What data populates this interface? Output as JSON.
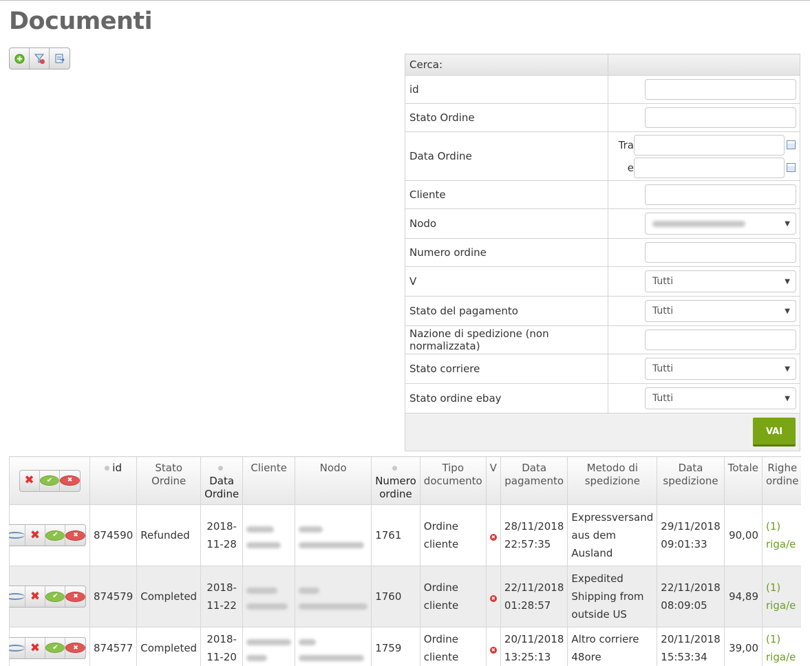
{
  "page": {
    "title": "Documenti"
  },
  "toolbar": {
    "icons": [
      "add-icon",
      "clear-filter-icon",
      "export-icon"
    ]
  },
  "search": {
    "header": "Cerca:",
    "fields": {
      "id": "id",
      "stato_ordine": "Stato Ordine",
      "data_ordine": "Data Ordine",
      "tra": "Tra",
      "e": "e",
      "cliente": "Cliente",
      "nodo": "Nodo",
      "numero_ordine": "Numero ordine",
      "v": "V",
      "stato_pagamento": "Stato del pagamento",
      "nazione": "Nazione di spedizione (non normalizzata)",
      "stato_corriere": "Stato corriere",
      "stato_ebay": "Stato ordine ebay"
    },
    "select_default": "Tutti",
    "submit": "VAI"
  },
  "grid": {
    "columns": {
      "id": "id",
      "stato": "Stato Ordine",
      "data": "Data Ordine",
      "cliente": "Cliente",
      "nodo": "Nodo",
      "numero": "Numero ordine",
      "tipo": "Tipo documento",
      "v": "V",
      "data_pag": "Data pagamento",
      "metodo": "Metodo di spedizione",
      "data_sped": "Data spedizione",
      "totale": "Totale",
      "righe": "Righe ordine"
    },
    "rows": [
      {
        "id": "874590",
        "stato": "Refunded",
        "data": "2018-11-28",
        "numero": "1761",
        "tipo": "Ordine cliente",
        "data_pag": "28/11/2018 22:57:35",
        "metodo": "Expressversand aus dem Ausland",
        "data_sped": "29/11/2018 09:01:33",
        "totale": "90,00",
        "righe": "(1) riga/e"
      },
      {
        "id": "874579",
        "stato": "Completed",
        "data": "2018-11-22",
        "numero": "1760",
        "tipo": "Ordine cliente",
        "data_pag": "22/11/2018 01:28:57",
        "metodo": "Expedited Shipping from outside US",
        "data_sped": "22/11/2018 08:09:05",
        "totale": "94,89",
        "righe": "(1) riga/e"
      },
      {
        "id": "874577",
        "stato": "Completed",
        "data": "2018-11-20",
        "numero": "1759",
        "tipo": "Ordine cliente",
        "data_pag": "20/11/2018 13:25:13",
        "metodo": "Altro corriere 48ore",
        "data_sped": "20/11/2018 15:53:34",
        "totale": "39,00",
        "righe": "(1) riga/e"
      }
    ]
  }
}
